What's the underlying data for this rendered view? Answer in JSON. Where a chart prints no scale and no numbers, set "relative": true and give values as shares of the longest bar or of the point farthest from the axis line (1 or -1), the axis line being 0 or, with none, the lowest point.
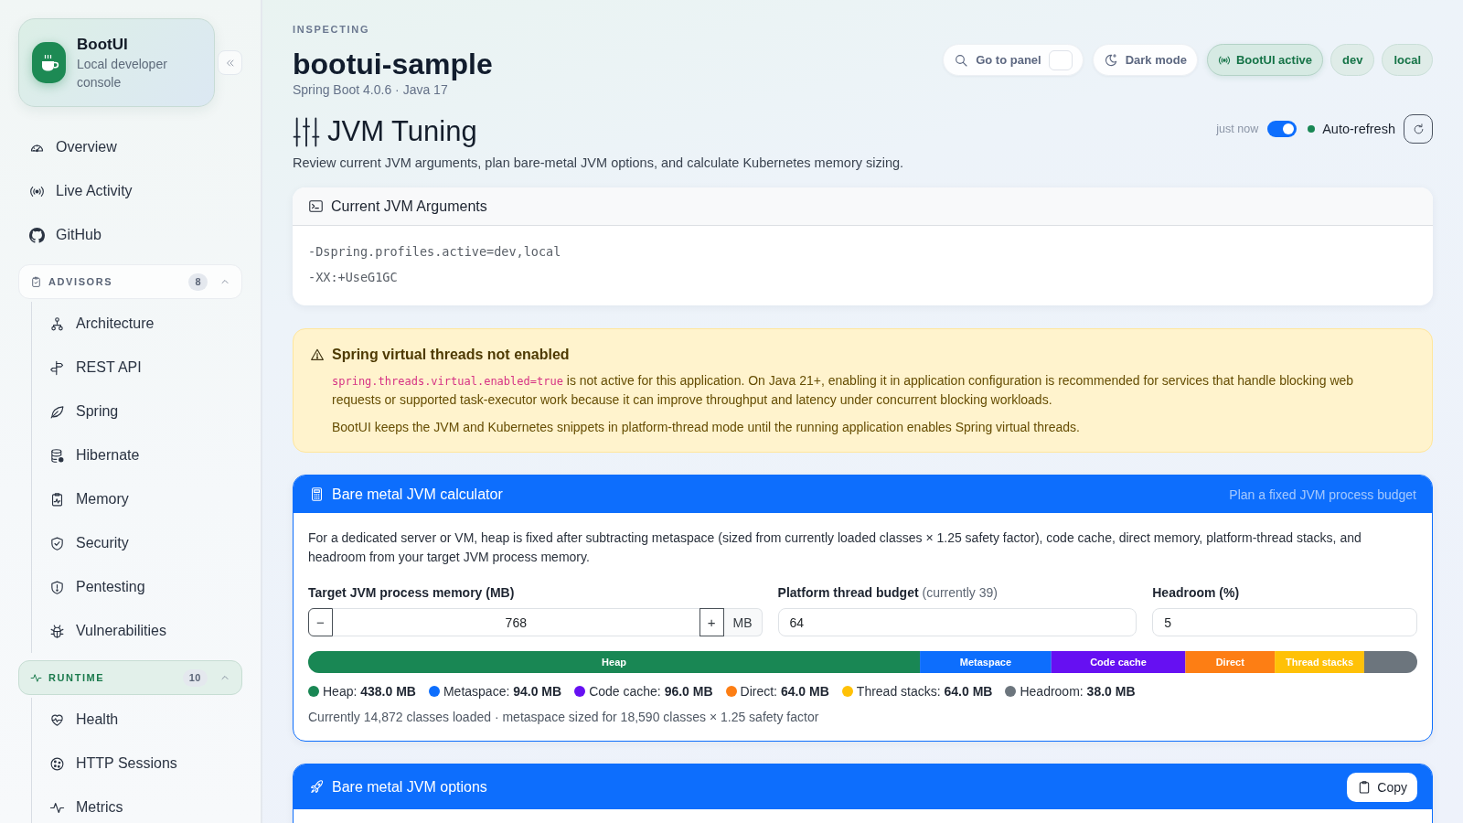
{
  "sidebar": {
    "brand": {
      "title": "BootUI",
      "subtitle": "Local developer console"
    },
    "nav": [
      {
        "label": "Overview",
        "selected": false
      },
      {
        "label": "Live Activity",
        "selected": false
      },
      {
        "label": "GitHub",
        "selected": false
      }
    ],
    "groups": [
      {
        "label": "ADVISORS",
        "count": "8",
        "expanded": true,
        "selected": false,
        "items": [
          {
            "label": "Architecture",
            "selected": false
          },
          {
            "label": "REST API",
            "selected": false
          },
          {
            "label": "Spring",
            "selected": false
          },
          {
            "label": "Hibernate",
            "selected": false
          },
          {
            "label": "Memory",
            "selected": false
          },
          {
            "label": "Security",
            "selected": false
          },
          {
            "label": "Pentesting",
            "selected": false
          },
          {
            "label": "Vulnerabilities",
            "selected": false
          }
        ]
      },
      {
        "label": "RUNTIME",
        "count": "10",
        "expanded": true,
        "selected": true,
        "items": [
          {
            "label": "Health",
            "selected": false
          },
          {
            "label": "HTTP Sessions",
            "selected": false
          },
          {
            "label": "Metrics",
            "selected": false
          }
        ]
      }
    ]
  },
  "header": {
    "eyebrow": "INSPECTING",
    "app_name": "bootui-sample",
    "subtitle": "Spring Boot 4.0.6 · Java 17",
    "buttons": [
      {
        "kind": "search",
        "label": "Go to panel"
      },
      {
        "kind": "theme",
        "label": "Dark mode"
      }
    ],
    "badges": [
      {
        "kind": "status",
        "label": "BootUI active"
      },
      {
        "kind": "profile",
        "label": "dev"
      },
      {
        "kind": "profile",
        "label": "local"
      }
    ]
  },
  "page": {
    "title": "JVM Tuning",
    "description": "Review current JVM arguments, plan bare-metal JVM options, and calculate Kubernetes memory sizing.",
    "refresh": {
      "updated": "just now",
      "auto_refresh": true,
      "label": "Auto-refresh"
    }
  },
  "current_args": {
    "title": "Current JVM Arguments",
    "arguments": [
      "-Dspring.profiles.active=dev,local",
      "-XX:+UseG1GC"
    ]
  },
  "warning": {
    "title": "Spring virtual threads not enabled",
    "paragraphs": [
      {
        "code": "spring.threads.virtual.enabled=true",
        "text": "is not active for this application. On Java 21+, enabling it in application configuration is recommended for services that handle blocking web requests or supported task-executor work because it can improve throughput and latency under concurrent blocking workloads."
      },
      {
        "text": "BootUI keeps the JVM and Kubernetes snippets in platform-thread mode until the running application enables Spring virtual threads."
      }
    ]
  },
  "calculator": {
    "title": "Bare metal JVM calculator",
    "hint": "Plan a fixed JVM process budget",
    "description": "For a dedicated server or VM, heap is fixed after subtracting metaspace (sized from currently loaded classes × 1.25 safety factor), code cache, direct memory, platform-thread stacks, and headroom from your target JVM process memory.",
    "fields": [
      {
        "kind": "stepper",
        "label": "Target JVM process memory (MB)",
        "value": "768",
        "decrement": "−",
        "increment": "+",
        "unit": "MB"
      },
      {
        "kind": "number",
        "label": "Platform thread budget",
        "note": "(currently 39)",
        "value": "64"
      },
      {
        "kind": "number",
        "label": "Headroom (%)",
        "value": "5"
      }
    ],
    "budget": {
      "chart_data": {
        "type": "bar",
        "orientation": "horizontal",
        "stacked": true,
        "relative": true,
        "series": [
          {
            "name": "Heap",
            "color": "#198754",
            "values": [
              0.5516
            ]
          },
          {
            "name": "Metaspace",
            "color": "#0d6efd",
            "values": [
              0.1184
            ]
          },
          {
            "name": "Code cache",
            "color": "#6610f2",
            "values": [
              0.1209
            ]
          },
          {
            "name": "Direct",
            "color": "#fd7e14",
            "values": [
              0.0806
            ]
          },
          {
            "name": "Thread stacks",
            "color": "#ffc107",
            "values": [
              0.0806
            ]
          },
          {
            "color": "#6c757d",
            "values": [
              0.0479
            ]
          }
        ]
      },
      "legend": [
        {
          "label": "Heap:",
          "amount": "438.0 MB"
        },
        {
          "label": "Metaspace:",
          "amount": "94.0 MB"
        },
        {
          "label": "Code cache:",
          "amount": "96.0 MB"
        },
        {
          "label": "Direct:",
          "amount": "64.0 MB"
        },
        {
          "label": "Thread stacks:",
          "amount": "64.0 MB"
        },
        {
          "label": "Headroom:",
          "amount": "38.0 MB"
        }
      ]
    },
    "footnote": "Currently 14,872 classes loaded · metaspace sized for 18,590 classes × 1.25 safety factor"
  },
  "options": {
    "title": "Bare metal JVM options",
    "copy_label": "Copy"
  }
}
